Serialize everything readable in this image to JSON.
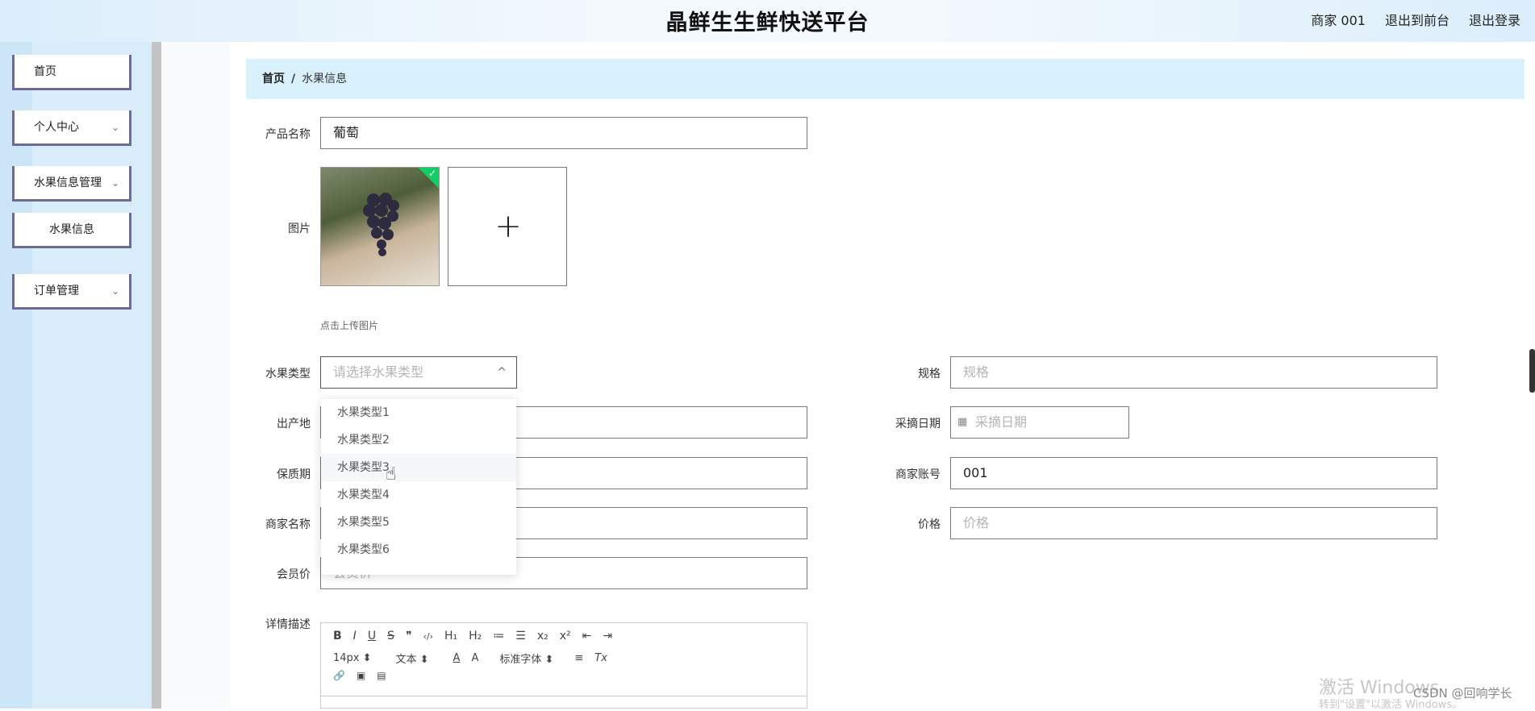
{
  "header": {
    "title": "晶鲜生生鲜快送平台",
    "links": [
      "商家 001",
      "退出到前台",
      "退出登录"
    ]
  },
  "sidebar": {
    "items": [
      {
        "label": "首页",
        "chevron": ""
      },
      {
        "label": "个人中心",
        "chevron": "⌄"
      },
      {
        "label": "水果信息管理",
        "chevron": "⌄"
      },
      {
        "label": "水果信息",
        "chevron": ""
      },
      {
        "label": "订单管理",
        "chevron": "⌄"
      }
    ]
  },
  "breadcrumb": {
    "home": "首页",
    "separator": "/",
    "current": "水果信息"
  },
  "form": {
    "product_name": {
      "label": "产品名称",
      "value": "葡萄"
    },
    "image": {
      "label": "图片",
      "hint": "点击上传图片",
      "add_symbol": "+"
    },
    "fruit_type": {
      "label": "水果类型",
      "placeholder": "请选择水果类型",
      "chevron": "^"
    },
    "spec": {
      "label": "规格",
      "placeholder": "规格"
    },
    "origin": {
      "label": "出产地",
      "value": ""
    },
    "pick_date": {
      "label": "采摘日期",
      "placeholder": "采摘日期"
    },
    "shelf_life": {
      "label": "保质期",
      "value": ""
    },
    "merchant_account": {
      "label": "商家账号",
      "value": "001"
    },
    "merchant_name": {
      "label": "商家名称",
      "value": ""
    },
    "price": {
      "label": "价格",
      "placeholder": "价格"
    },
    "member_price": {
      "label": "会员价",
      "placeholder": "会员价"
    },
    "description": {
      "label": "详情描述"
    }
  },
  "dropdown": {
    "options": [
      "水果类型1",
      "水果类型2",
      "水果类型3",
      "水果类型4",
      "水果类型5",
      "水果类型6"
    ],
    "hovered_index": 2
  },
  "editor_toolbar": {
    "row1": [
      "B",
      "I",
      "U",
      "S",
      "❞",
      "‹/›",
      "H₁",
      "H₂",
      "≔",
      "☰",
      "x₂",
      "x²",
      "⇤",
      "⇥"
    ],
    "row2": [
      "14px ⬍",
      "文本 ⬍",
      "A",
      "A",
      "标准字体 ⬍",
      "≡",
      "Tx"
    ],
    "row3": [
      "🔗",
      "▣",
      "▤"
    ]
  },
  "watermark": {
    "line1": "激活 Windows",
    "line2": "转到\"设置\"以激活 Windows。",
    "csdn": "CSDN @回响学长"
  }
}
